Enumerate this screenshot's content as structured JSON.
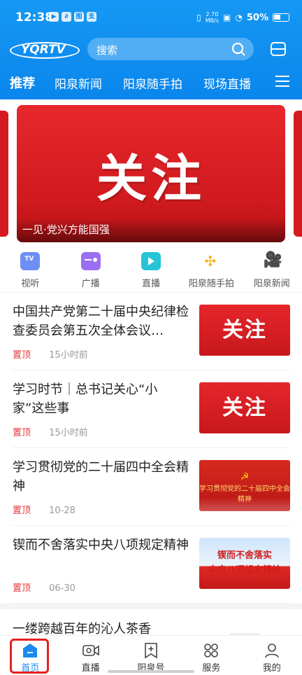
{
  "status": {
    "time": "12:38",
    "app_icons": [
      "▶",
      "∂",
      "图",
      "支"
    ],
    "speed_value": "2.70",
    "speed_unit": "MB/s",
    "battery": "50%"
  },
  "header": {
    "logo": "YQRTV",
    "search_placeholder": "搜索"
  },
  "tabs": [
    "推荐",
    "阳泉新闻",
    "阳泉随手拍",
    "现场直播"
  ],
  "banner": {
    "headline": "关注",
    "caption": "一见·党兴方能国强"
  },
  "quick_links": [
    {
      "label": "视听",
      "color": "#6d8ff5"
    },
    {
      "label": "广播",
      "color": "#9b6ff2"
    },
    {
      "label": "直播",
      "color": "#27c3d6"
    },
    {
      "label": "阳泉随手拍",
      "color": "#f6b21a"
    },
    {
      "label": "阳泉新闻",
      "color": "#3f78d8"
    }
  ],
  "news": [
    {
      "title": "中国共产党第二十届中央纪律检查委员会第五次全体会议…",
      "pin": "置顶",
      "time": "15小时前",
      "thumb_style": "red",
      "thumb_text": "关注"
    },
    {
      "title": "学习时节｜总书记关心“小家”这些事",
      "pin": "置顶",
      "time": "15小时前",
      "thumb_style": "red",
      "thumb_text": "关注"
    },
    {
      "title": "学习贯彻党的二十届四中全会精神",
      "pin": "置顶",
      "time": "10-28",
      "thumb_style": "party",
      "thumb_text": "学习贯彻党的二十届四中全会精神"
    },
    {
      "title": "锲而不舍落实中央八项规定精神",
      "pin": "置顶",
      "time": "06-30",
      "thumb_style": "blue",
      "thumb_text": "锲而不舍落实中央八项规定精神",
      "thumb_l1": "锲而不舍落实",
      "thumb_l2": "中央八项规定精神"
    }
  ],
  "partial_item": "一缕跨越百年的沁人茶香",
  "bottom_nav": [
    "首页",
    "直播",
    "阳泉号",
    "服务",
    "我的"
  ],
  "colors": {
    "brand": "#0a86ec",
    "accent_red": "#e5383b",
    "highlight": "#e32121"
  }
}
